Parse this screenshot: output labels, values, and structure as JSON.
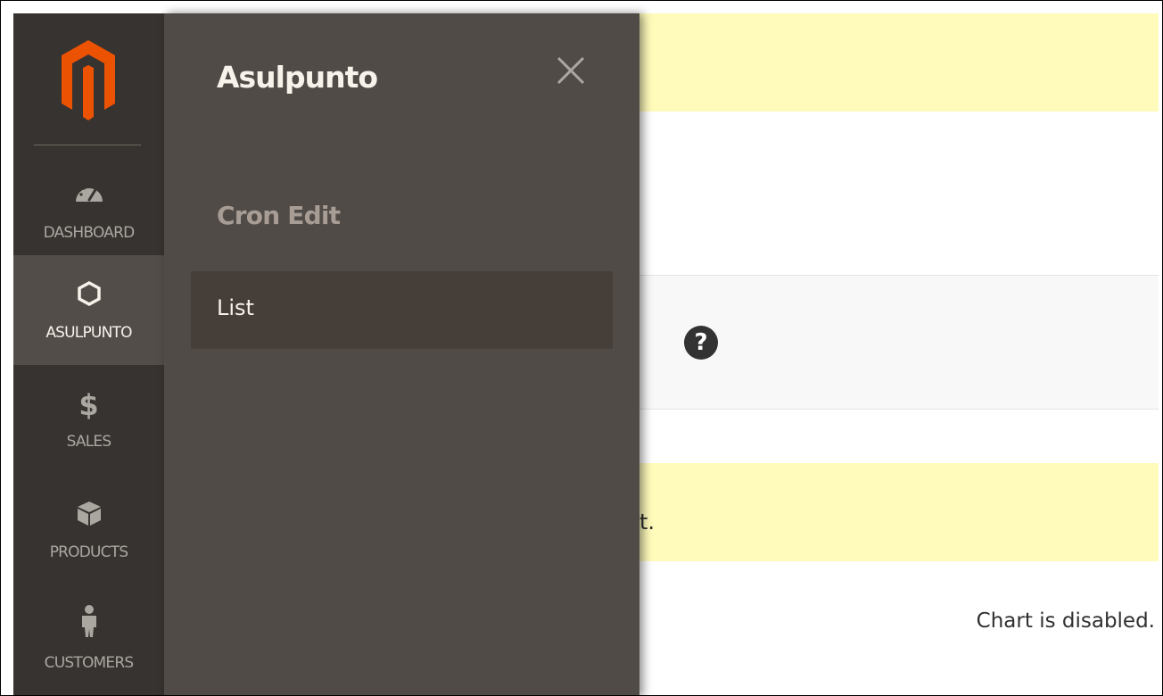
{
  "colors": {
    "nav_bg": "#373330",
    "nav_active_bg": "#524d49",
    "flyout_bg": "#514b48",
    "flyout_item_active_bg": "#463e39",
    "logo_orange": "#eb5202",
    "message_bg": "#fffbbb"
  },
  "nav": {
    "items": [
      {
        "label": "DASHBOARD",
        "icon": "dashboard-gauge-icon"
      },
      {
        "label": "ASULPUNTO",
        "icon": "hexagon-icon"
      },
      {
        "label": "SALES",
        "icon": "dollar-icon"
      },
      {
        "label": "PRODUCTS",
        "icon": "box-icon"
      },
      {
        "label": "CUSTOMERS",
        "icon": "person-icon"
      }
    ]
  },
  "flyout": {
    "title": "Asulpunto",
    "close_icon": "close-icon",
    "group_title": "Cron Edit",
    "items": [
      {
        "label": "List"
      }
    ]
  },
  "content": {
    "message_fragment": "t.",
    "help_symbol": "?",
    "chart_message": "Chart is disabled."
  }
}
